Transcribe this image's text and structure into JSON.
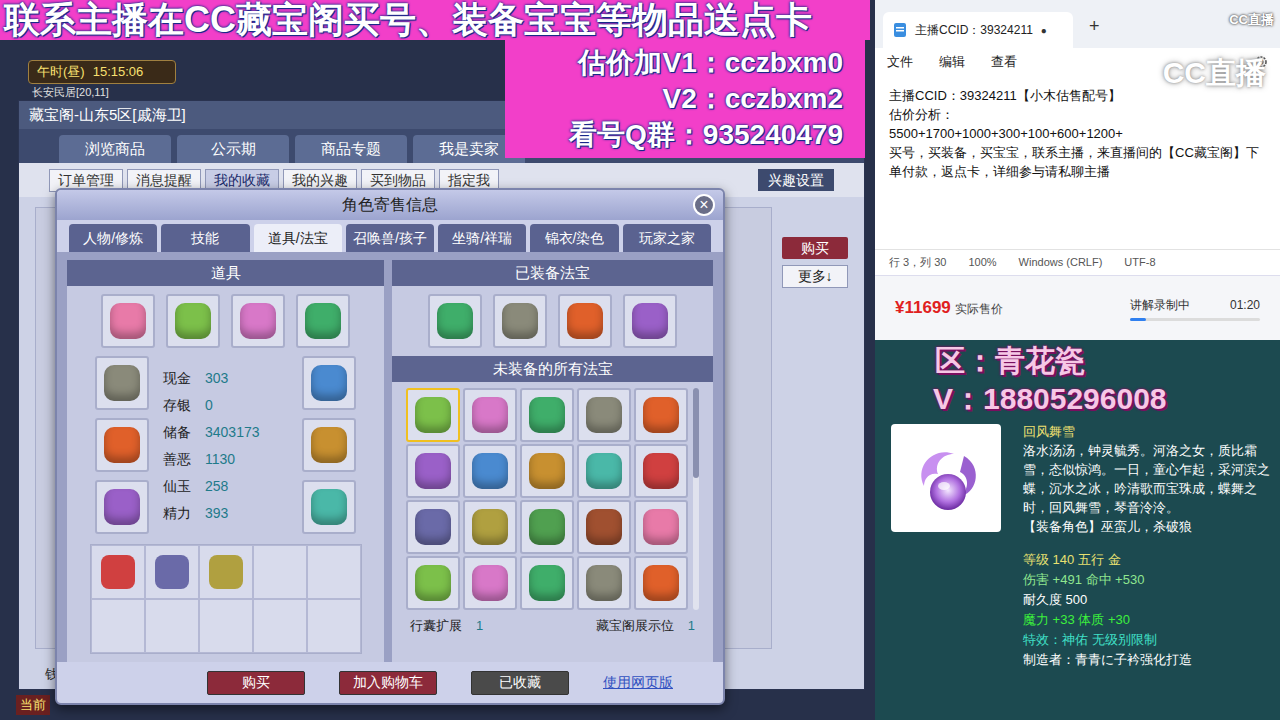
{
  "banner": {
    "headline": "联系主播在CC藏宝阁买号、装备宝宝等物品送点卡",
    "lines": [
      "估价加V1：cczbxm0",
      "V2：cczbxm2",
      "看号Q群：935240479"
    ]
  },
  "game": {
    "clock": {
      "period": "午时(昼)",
      "time": "15:15:06"
    },
    "location": "长安民居[20,11]",
    "window_title": "藏宝阁-山东5区[戚海卫]",
    "nav_tabs": [
      {
        "label": "浏览商品",
        "selected": false
      },
      {
        "label": "公示期",
        "selected": false
      },
      {
        "label": "商品专题",
        "selected": false
      },
      {
        "label": "我是卖家",
        "selected": false
      }
    ],
    "sub_tabs": [
      {
        "label": "订单管理",
        "selected": false
      },
      {
        "label": "消息提醒",
        "selected": false
      },
      {
        "label": "我的收藏",
        "selected": true
      },
      {
        "label": "我的兴趣",
        "selected": false
      },
      {
        "label": "买到物品",
        "selected": false
      },
      {
        "label": "指定我",
        "selected": false
      }
    ],
    "interest_button": "兴趣设置",
    "buy_button": "购买",
    "more_button": "更多↓",
    "side_label": "钱",
    "bottom_label": "当前"
  },
  "dialog": {
    "title": "角色寄售信息",
    "close": "×",
    "tabs": [
      {
        "label": "人物/修炼",
        "selected": false
      },
      {
        "label": "技能",
        "selected": false
      },
      {
        "label": "道具/法宝",
        "selected": true
      },
      {
        "label": "召唤兽/孩子",
        "selected": false
      },
      {
        "label": "坐骑/祥瑞",
        "selected": false
      },
      {
        "label": "锦衣/染色",
        "selected": false
      },
      {
        "label": "玩家之家",
        "selected": false
      }
    ],
    "items_panel": {
      "title": "道具",
      "top_slots": [
        {
          "filled": true
        },
        {
          "filled": true
        },
        {
          "filled": true
        },
        {
          "filled": true
        }
      ],
      "left_slots": [
        {
          "filled": true
        },
        {
          "filled": true
        },
        {
          "filled": true
        }
      ],
      "right_slots": [
        {
          "filled": true
        },
        {
          "filled": true
        },
        {
          "filled": true
        }
      ],
      "stats": [
        {
          "label": "现金",
          "value": "303"
        },
        {
          "label": "存银",
          "value": "0"
        },
        {
          "label": "储备",
          "value": "3403173"
        },
        {
          "label": "善恶",
          "value": "1130"
        },
        {
          "label": "仙玉",
          "value": "258"
        },
        {
          "label": "精力",
          "value": "393"
        }
      ],
      "bag_slots": [
        {
          "filled": true
        },
        {
          "filled": true
        },
        {
          "filled": true
        },
        {
          "filled": false
        },
        {
          "filled": false
        },
        {
          "filled": false
        },
        {
          "filled": false
        },
        {
          "filled": false
        },
        {
          "filled": false
        },
        {
          "filled": false
        }
      ]
    },
    "fabao_panel": {
      "title": "已装备法宝",
      "equipped": [
        {
          "filled": true
        },
        {
          "filled": true
        },
        {
          "filled": true
        },
        {
          "filled": true
        }
      ],
      "unequipped_title": "未装备的所有法宝",
      "unequipped": [
        {
          "selected": true
        },
        {
          "selected": false
        },
        {
          "selected": false
        },
        {
          "selected": false
        },
        {
          "selected": false
        },
        {
          "selected": false
        },
        {
          "selected": false
        },
        {
          "selected": false
        },
        {
          "selected": false
        },
        {
          "selected": false
        },
        {
          "selected": false
        },
        {
          "selected": false
        },
        {
          "selected": false
        },
        {
          "selected": false
        },
        {
          "selected": false
        },
        {
          "selected": false
        },
        {
          "selected": false
        },
        {
          "selected": false
        },
        {
          "selected": false
        },
        {
          "selected": false
        }
      ],
      "expansion": {
        "label": "行囊扩展",
        "value": "1"
      },
      "showcase": {
        "label": "藏宝阁展示位",
        "value": "1"
      }
    },
    "buttons": [
      {
        "label": "购买",
        "kind": "primary"
      },
      {
        "label": "加入购物车",
        "kind": "primary"
      },
      {
        "label": "已收藏",
        "kind": "muted"
      },
      {
        "label": "使用网页版",
        "kind": "link"
      }
    ]
  },
  "notepad": {
    "tab_title": "主播CCID：39324211",
    "tab_mark": "●",
    "new_tab": "+",
    "menu": [
      "文件",
      "编辑",
      "查看"
    ],
    "lines": [
      "主播CCID：39324211【小木估售配号】",
      "估价分析：",
      "5500+1700+1000+300+100+600+1200+",
      "买号，买装备，买宝宝，联系主播，来直播间的【CC藏宝阁】下单付款，返点卡，详细参与请私聊主播"
    ],
    "status": [
      "行 3，列 30",
      "100%",
      "Windows (CRLF)",
      "UTF-8"
    ],
    "logo_large": "CC直播",
    "logo_small": "CC直播"
  },
  "price_panel": {
    "price": "¥11699",
    "price_label": "实际售价",
    "recording_label": "讲解录制中",
    "recording_time": "01:20",
    "level": 0.12
  },
  "overlay": {
    "region": "区：青花瓷",
    "contact": "V：18805296008"
  },
  "tooltip": {
    "name": "回风舞雪",
    "description": "洛水汤汤，钟灵毓秀。河洛之女，质比霜雪，态似惊鸿。一日，童心乍起，采河滨之蝶，沉水之冰，吟清歌而宝珠成，蝶舞之时，回风舞雪，琴音泠泠。",
    "roles": "【装备角色】巫蛮儿，杀破狼",
    "lines": [
      {
        "text": "等级 140 五行 金",
        "color": "#e8e070"
      },
      {
        "text": "伤害 +491 命中 +530",
        "color": "#8fe68f"
      },
      {
        "text": "耐久度 500",
        "color": "#ffffff"
      },
      {
        "text": "魔力 +33 体质 +30",
        "color": "#3cf03c"
      },
      {
        "text": "特效：神佑 无级别限制",
        "color": "#40e0c8"
      },
      {
        "text": "制造者：青青に子衿强化打造",
        "color": "#ffffff"
      }
    ]
  }
}
